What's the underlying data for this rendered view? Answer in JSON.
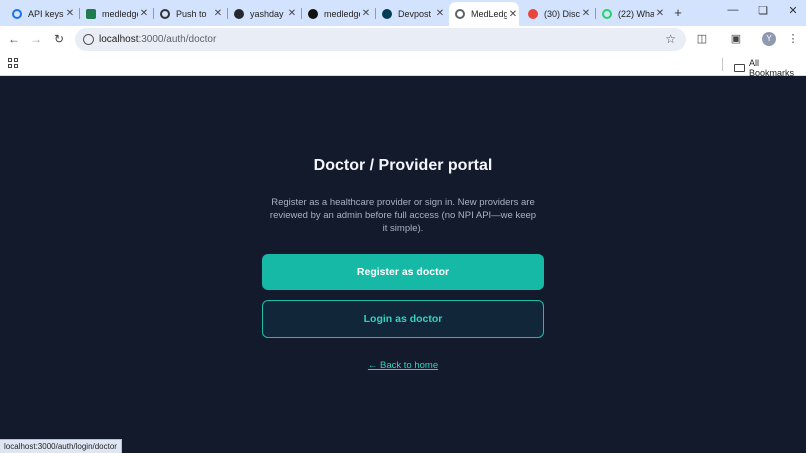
{
  "browser": {
    "tabs": [
      {
        "title": "API keys",
        "favicon_color": "#1a73e8"
      },
      {
        "title": "medledge",
        "favicon_color": "#1f7a4d"
      },
      {
        "title": "Push to",
        "favicon_color": "#333333"
      },
      {
        "title": "yashday",
        "favicon_color": "#24292f"
      },
      {
        "title": "medledge",
        "favicon_color": "#111111"
      },
      {
        "title": "Devpost",
        "favicon_color": "#003e54"
      },
      {
        "title": "MedLedge",
        "favicon_color": "#5f6368",
        "active": true
      },
      {
        "title": "(30) Disc",
        "favicon_color": "#e8453c"
      },
      {
        "title": "(22) Wha",
        "favicon_color": "#25d366"
      }
    ],
    "new_tab_glyph": "+",
    "address": {
      "host": "localhost",
      "path": ":3000/auth/doctor"
    },
    "profile_initial": "Y",
    "all_bookmarks_label": "All Bookmarks"
  },
  "page": {
    "title": "Doctor / Provider portal",
    "description": "Register as a healthcare provider or sign in. New providers are reviewed by an admin before full access (no NPI API—we keep it simple).",
    "register_button": "Register as doctor",
    "login_button": "Login as doctor",
    "back_link": "← Back to home"
  },
  "status_bar": "localhost:3000/auth/login/doctor",
  "colors": {
    "page_bg": "#131a2b",
    "accent": "#16b8a6",
    "accent_text": "#2dd4bf"
  }
}
